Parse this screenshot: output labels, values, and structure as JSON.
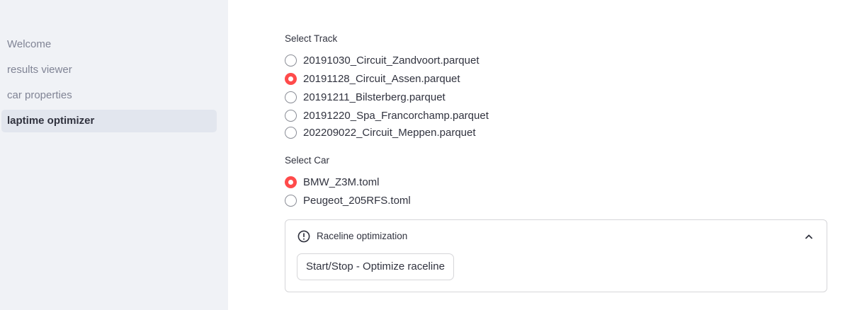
{
  "sidebar": {
    "items": [
      {
        "label": "Welcome"
      },
      {
        "label": "results viewer"
      },
      {
        "label": "car properties"
      },
      {
        "label": "laptime optimizer",
        "active": true
      }
    ]
  },
  "track_select": {
    "label": "Select Track",
    "selected": "20191128_Circuit_Assen.parquet",
    "options": [
      "20191030_Circuit_Zandvoort.parquet",
      "20191128_Circuit_Assen.parquet",
      "20191211_Bilsterberg.parquet",
      "20191220_Spa_Francorchamp.parquet",
      "202209022_Circuit_Meppen.parquet"
    ]
  },
  "car_select": {
    "label": "Select Car",
    "selected": "BMW_Z3M.toml",
    "options": [
      "BMW_Z3M.toml",
      "Peugeot_205RFS.toml"
    ]
  },
  "expander": {
    "title": "Raceline optimization",
    "icon": "exclamation-circle-icon",
    "expanded": true,
    "button_label": "Start/Stop - Optimize raceline"
  },
  "colors": {
    "accent": "#ff4b4b",
    "sidebar_bg": "#f0f2f6",
    "active_item_bg": "#e2e6ee"
  }
}
